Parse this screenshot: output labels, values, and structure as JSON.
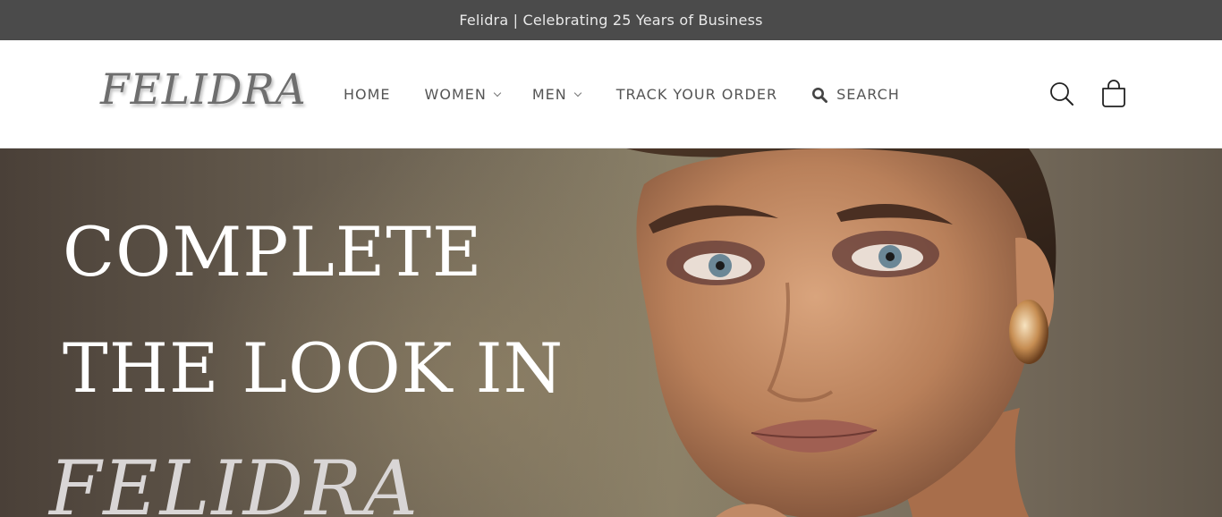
{
  "announcement": {
    "text": "Felidra | Celebrating 25 Years of Business"
  },
  "header": {
    "logo": "FELIDRA",
    "nav": [
      {
        "label": "HOME"
      },
      {
        "label": "WOMEN"
      },
      {
        "label": "MEN"
      },
      {
        "label": "TRACK YOUR ORDER"
      },
      {
        "label": "SEARCH"
      }
    ],
    "icons": {
      "search": "search-icon",
      "cart": "cart-icon"
    }
  },
  "hero": {
    "line1": "COMPLETE",
    "line2": "THE LOOK IN",
    "brand": "FELIDRA"
  },
  "colors": {
    "announcement_bg": "#4b4b4b",
    "nav_text": "#555555",
    "hero_text": "#ffffff"
  }
}
